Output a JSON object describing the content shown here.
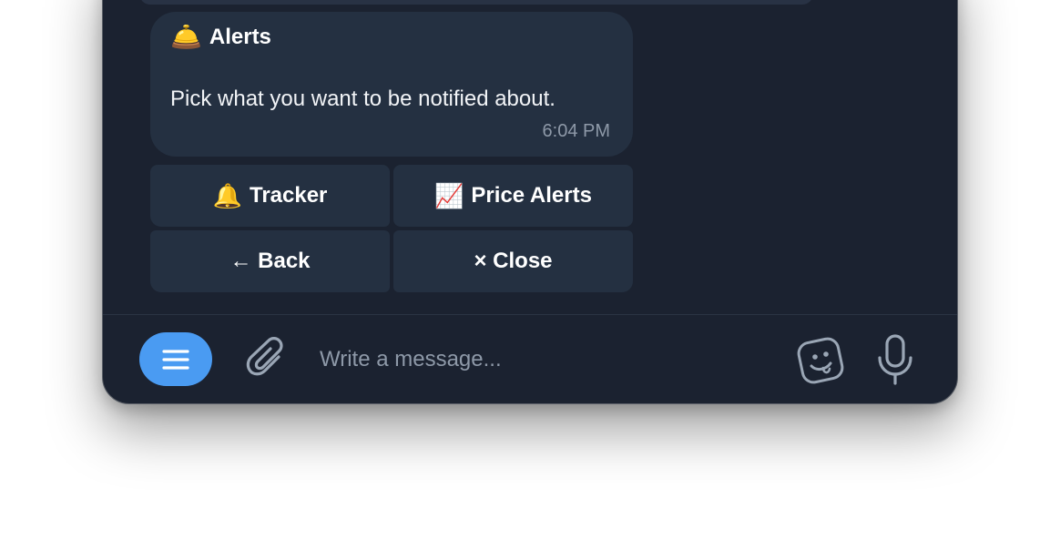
{
  "message": {
    "title_emoji": "🛎️",
    "title": "Alerts",
    "text": "Pick what you want to be notified about.",
    "time": "6:04 PM"
  },
  "keyboard": {
    "buttons": [
      {
        "emoji": "🔔",
        "label": "Tracker"
      },
      {
        "emoji": "📈",
        "label": "Price Alerts"
      },
      {
        "emoji": "",
        "label": "← Back"
      },
      {
        "emoji": "",
        "label": "× Close"
      }
    ]
  },
  "composer": {
    "placeholder": "Write a message...",
    "menu_icon": "menu-icon",
    "attach_icon": "paperclip-icon",
    "sticker_icon": "sticker-icon",
    "mic_icon": "microphone-icon",
    "accent_color": "#4a9bf2"
  },
  "theme": {
    "background": "#1b2230",
    "bubble": "#243041"
  }
}
